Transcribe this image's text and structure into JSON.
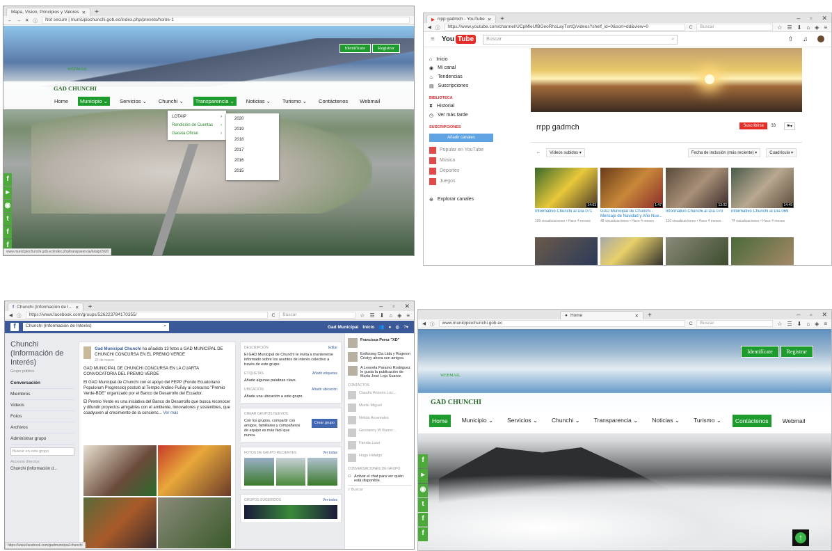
{
  "site1": {
    "tab_title": "Mapa, Vision, Principios y Valores",
    "url": "Not secure | municipiochunchi.gob.ec/index.php/presets/home-1",
    "auth": [
      "Identifícate",
      "Registrar"
    ],
    "webmail_label": "WEBMAIL",
    "brand": "GAD CHUNCHI",
    "nav": [
      "Home",
      "Municipio ⌄",
      "Servicios ⌄",
      "Chunchi ⌄",
      "Transparencia ⌄",
      "Noticias ⌄",
      "Turismo ⌄",
      "Contáctenos",
      "Webmail"
    ],
    "dropdown": [
      "LOTAIP",
      "Rendición de Cuentas",
      "Gaceta Oficial"
    ],
    "years": [
      "2020",
      "2019",
      "2018",
      "2017",
      "2016",
      "2015"
    ],
    "status": "www.municipiochunchi.gob.ec/index.php/transparencia/lotaip/2020"
  },
  "youtube": {
    "tab_title": "rrpp gadmch - YouTube",
    "url": "https://www.youtube.com/channel/UCpMleUfBGeoRhsLayTxrtQ/videos?shelf_id=0&sort=dd&view=0",
    "search_placeholder": "Buscar",
    "browser_search": "Buscar",
    "logo_you": "You",
    "logo_tube": "Tube",
    "sidebar": {
      "items": [
        "Inicio",
        "Mi canal",
        "Tendencias",
        "Suscripciones"
      ],
      "library_header": "BIBLIOTECA",
      "library": [
        "Historial",
        "Ver más tarde"
      ],
      "subs_header": "SUSCRIPCIONES",
      "add_channels": "Añadir canales",
      "subs": [
        "Popular en YouTube",
        "Música",
        "Deportes",
        "Juegos"
      ],
      "explore": "Explorar canales"
    },
    "channel_name": "rrpp gadmch",
    "subscribe": "Suscribirse",
    "sub_count": "33",
    "filter_uploaded": "Vídeos subidos ▾",
    "filter_sort": "Fecha de inclusión (más reciente) ▾",
    "filter_view": "Cuadrícula ▾",
    "videos": [
      {
        "title": "Informativo Chunchi al Día 071",
        "meta": "109 visualizaciones • Hace 4 meses",
        "dur": "14:03"
      },
      {
        "title": "GAD Municipal de Chunchi - Mensaje de Navidad y Año Nue...",
        "meta": "48 visualizaciones • Hace 4 meses",
        "dur": "1:47"
      },
      {
        "title": "Informativo Chunchi al Día 070",
        "meta": "110 visualizaciones • Hace 4 meses",
        "dur": "13:02"
      },
      {
        "title": "Informativo Chunchi al Día 069",
        "meta": "74 visualizaciones • Hace 4 meses",
        "dur": "14:49"
      }
    ]
  },
  "facebook": {
    "tab_title": "Chunchi (Información de I...",
    "url": "https://www.facebook.com/groups/526223784170355/",
    "browser_search": "Buscar",
    "search_value": "Chunchi (Información de Interés)",
    "top_links": [
      "Gad Municipal",
      "Inicio"
    ],
    "group_name": "Chunchi (Información de Interés)",
    "group_type": "Grupo público",
    "left_items": [
      "Conversación",
      "Miembros",
      "Videos",
      "Fotos",
      "Archivos",
      "Administrar grupo"
    ],
    "group_search": "Buscar en este grupo",
    "shortcuts_header": "Accesos directos",
    "shortcut": "Chunchi (Información d...",
    "post_author": "Gad Municipal Chunchi",
    "post_action": "ha añadido 13 fotos a GAD MUNICIPAL DE CHUNCHI CONCURSA EN EL PREMIO VERDE",
    "post_date": "22 de marzo",
    "post_p1": "GAD MUNICIPAL DE CHUNCHI CONCURSA EN LA CUARTA CONVOCATORIA DEL PREMIO VERDE",
    "post_p2": "El GAD Municipal de Chunchi con el apoyo del FEPP (Fondo Ecuatoriano Populorum Progressio) postuló al Templo Andino Puñay al concurso \"Premio Verde-BDE\" organizado por el Banco de Desarrollo del Ecuador.",
    "post_p3": "El Premio Verde es una iniciativa del Banco de Desarrollo que busca reconocer y difundir proyectos amigables con el ambiente, innovadores y sostenibles, que coadyuven al crecimiento de la concienc...",
    "see_more": "Ver más",
    "desc_header": "DESCRIPCIÓN",
    "edit": "Editar",
    "desc_text": "El GAD Municipal de Chunchi te invita a mantenerse informado sobre los asuntos de interés colectivo a través de este grupo.",
    "tags_header": "ETIQUETAS",
    "add_tags": "Añadir etiquetas",
    "tags_text": "Añade algunas palabras clave.",
    "loc_header": "UBICACIÓN",
    "add_loc": "Añadir ubicación",
    "loc_text": "Añade una ubicación a este grupo.",
    "new_groups_header": "CREAR GRUPOS NUEVOS",
    "new_groups_text": "Con los grupos, compartir con amigos, familiares y compañeros de equipo es más fácil que nunca.",
    "create_group": "Crear grupo",
    "recent_photos": "FOTOS DE GRUPO RECIENTES",
    "see_all": "Ver todas",
    "suggested": "GRUPOS SUGERIDOS",
    "see_all2": "Ver todos",
    "chat_news": [
      "Francisca Perez \"XD\"",
      "Estforseg Cia Ltda y Rogeron Cristyy ahora son amigos.",
      "A Leonela Paramo Rodriguez le gusta la publicación de María José Loja Suarez."
    ],
    "contacts_header": "CONTACTOS",
    "contacts": [
      "Claudio Antonio Loz...",
      "Murilo Miguel",
      "Nelida Arcentales",
      "Geovanny W Barrer...",
      "Fanida Loza",
      "Hugo Hidalgo"
    ],
    "group_conv": "CONVERSACIONES DE GRUPO",
    "chat_activate": "Activar el chat para ver quién está disponible.",
    "chat_search": "Buscar",
    "status": "https://www.facebook.com/gadmunicipal.chunchi"
  },
  "site4": {
    "tab_title": "Home",
    "url": "www.municipiochunchi.gob.ec",
    "browser_search": "Buscar",
    "auth": [
      "Identifícate",
      "Registrar"
    ],
    "webmail_label": "WEBMAIL",
    "brand": "GAD CHUNCHI",
    "nav": [
      "Home",
      "Municipio ⌄",
      "Servicios ⌄",
      "Chunchi ⌄",
      "Transparencia ⌄",
      "Noticias ⌄",
      "Turismo ⌄",
      "Contáctenos",
      "Webmail"
    ]
  },
  "colors": {
    "green": "#1e9b2d",
    "fb_blue": "#3b5998",
    "yt_red": "#e52d27"
  }
}
